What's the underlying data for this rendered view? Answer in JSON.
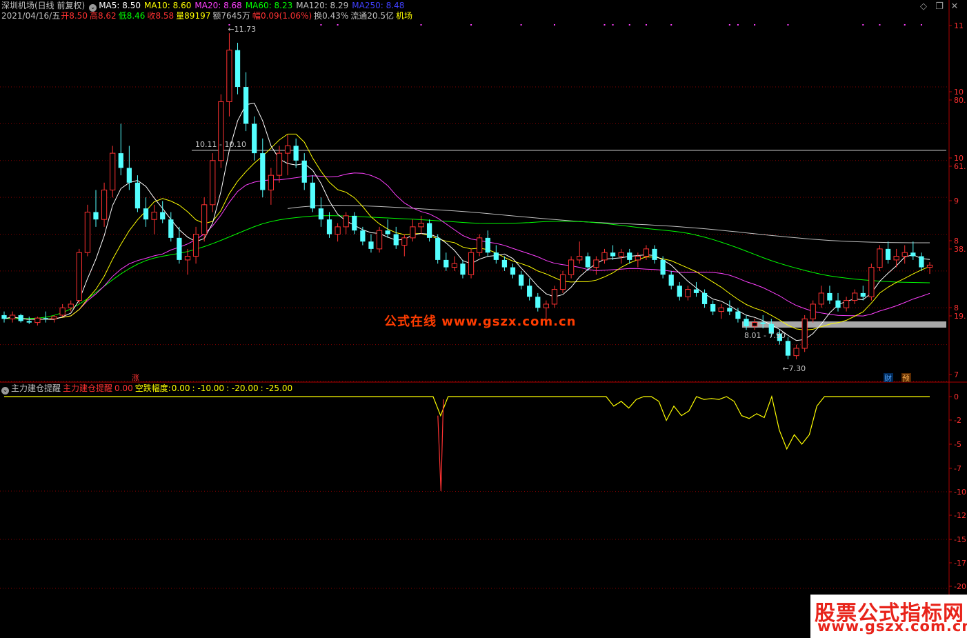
{
  "header": {
    "title": "深圳机场(日线 前复权)",
    "ma": [
      {
        "label": "MA5:",
        "value": "8.50",
        "color": "#ffffff"
      },
      {
        "label": "MA10:",
        "value": "8.60",
        "color": "#ffff00"
      },
      {
        "label": "MA20:",
        "value": "8.68",
        "color": "#ff40ff"
      },
      {
        "label": "MA60:",
        "value": "8.23",
        "color": "#00ff00"
      },
      {
        "label": "MA120:",
        "value": "8.29",
        "color": "#c0c0c0"
      },
      {
        "label": "MA250:",
        "value": "8.48",
        "color": "#4040ff"
      }
    ],
    "date": "2021/04/16/五",
    "open_label": "开",
    "open": "8.50",
    "high_label": "高",
    "high": "8.62",
    "low_label": "低",
    "low": "8.46",
    "close_label": "收",
    "close": "8.58",
    "volume_label": "量",
    "volume": "89197",
    "amount_label": "额",
    "amount": "7645万",
    "change_label": "幅",
    "change": "0.09(1.06%)",
    "turnover_label": "换",
    "turnover": "0.43%",
    "float_label": "流通",
    "float": "20.5亿",
    "sector": "机场"
  },
  "indicator": {
    "name": "主力建仓提醒",
    "line_name": "主力建仓提醒",
    "line_value": "0.00",
    "fall_label": "空跌幅度:",
    "fall_values": [
      "0.00",
      "-10.00",
      "-20.00",
      "-25.00"
    ]
  },
  "annotations": {
    "high": "11.73",
    "low": "7.30",
    "level1": "10.11 - 10.10",
    "level2": "8.01 - 7.90",
    "limit_up": "涨",
    "fin": "财",
    "pre": "预"
  },
  "watermark": {
    "mid": "公式在线  www.gszx.com.cn",
    "corner1": "股票公式指标网",
    "corner2": "www.gszx.com.cn"
  },
  "colors": {
    "up": "#ff3232",
    "down": "#54ffff",
    "ma5": "#ffffff",
    "ma10": "#ffff00",
    "ma20": "#ff40ff",
    "ma60": "#00ff00",
    "ma120": "#c0c0c0",
    "ma250": "#4040ff",
    "grid": "#8b0000",
    "axis": "#b00000"
  },
  "chart_data": [
    {
      "type": "candlestick",
      "title": "深圳机场(日线 前复权)",
      "y_ticks_visible": [
        "11",
        "10",
        "80.",
        "10",
        "61.",
        "9",
        "8",
        "38.",
        "8",
        "19.",
        "7"
      ],
      "ylim": [
        7.0,
        11.9
      ],
      "annotations": {
        "max": 11.73,
        "min": 7.3,
        "h_line": 10.1
      },
      "candles": [
        [
          7.9,
          7.95,
          7.8,
          7.85
        ],
        [
          7.85,
          7.95,
          7.8,
          7.9
        ],
        [
          7.9,
          7.92,
          7.8,
          7.82
        ],
        [
          7.82,
          7.88,
          7.78,
          7.8
        ],
        [
          7.8,
          7.88,
          7.76,
          7.86
        ],
        [
          7.86,
          7.95,
          7.8,
          7.85
        ],
        [
          7.85,
          7.9,
          7.8,
          7.88
        ],
        [
          7.9,
          8.05,
          7.88,
          8.0
        ],
        [
          8.0,
          8.1,
          7.95,
          8.05
        ],
        [
          8.1,
          8.8,
          8.05,
          8.75
        ],
        [
          8.75,
          9.4,
          8.7,
          9.3
        ],
        [
          9.3,
          9.6,
          9.1,
          9.2
        ],
        [
          9.2,
          9.7,
          9.1,
          9.6
        ],
        [
          9.6,
          10.2,
          9.5,
          10.1
        ],
        [
          10.1,
          10.5,
          9.8,
          9.9
        ],
        [
          9.9,
          10.2,
          9.6,
          9.7
        ],
        [
          9.7,
          9.8,
          9.3,
          9.35
        ],
        [
          9.35,
          9.5,
          9.1,
          9.2
        ],
        [
          9.2,
          9.4,
          9.0,
          9.3
        ],
        [
          9.3,
          9.45,
          9.15,
          9.2
        ],
        [
          9.2,
          9.3,
          8.9,
          8.95
        ],
        [
          8.95,
          9.1,
          8.6,
          8.65
        ],
        [
          8.65,
          8.8,
          8.45,
          8.7
        ],
        [
          8.7,
          9.1,
          8.6,
          9.0
        ],
        [
          9.0,
          9.5,
          8.9,
          9.4
        ],
        [
          9.4,
          10.1,
          9.3,
          10.0
        ],
        [
          10.0,
          10.9,
          9.9,
          10.8
        ],
        [
          10.8,
          11.73,
          10.6,
          11.5
        ],
        [
          11.5,
          11.6,
          10.9,
          11.0
        ],
        [
          11.0,
          11.2,
          10.4,
          10.5
        ],
        [
          10.5,
          10.6,
          10.0,
          10.1
        ],
        [
          10.1,
          10.3,
          9.5,
          9.6
        ],
        [
          9.6,
          9.9,
          9.4,
          9.8
        ],
        [
          9.8,
          10.2,
          9.7,
          10.1
        ],
        [
          10.1,
          10.35,
          9.8,
          10.2
        ],
        [
          10.2,
          10.3,
          9.9,
          10.0
        ],
        [
          10.0,
          10.1,
          9.6,
          9.7
        ],
        [
          9.7,
          9.8,
          9.3,
          9.35
        ],
        [
          9.35,
          9.5,
          9.1,
          9.2
        ],
        [
          9.2,
          9.3,
          8.95,
          9.0
        ],
        [
          9.0,
          9.15,
          8.9,
          9.1
        ],
        [
          9.1,
          9.3,
          9.0,
          9.25
        ],
        [
          9.25,
          9.3,
          9.0,
          9.05
        ],
        [
          9.05,
          9.1,
          8.85,
          8.9
        ],
        [
          8.9,
          9.0,
          8.75,
          8.8
        ],
        [
          8.8,
          9.1,
          8.75,
          9.05
        ],
        [
          9.05,
          9.2,
          8.95,
          9.0
        ],
        [
          9.0,
          9.1,
          8.8,
          8.85
        ],
        [
          8.85,
          9.0,
          8.7,
          8.95
        ],
        [
          8.95,
          9.2,
          8.9,
          9.1
        ],
        [
          9.1,
          9.25,
          9.0,
          9.15
        ],
        [
          9.15,
          9.2,
          8.9,
          8.95
        ],
        [
          8.95,
          9.0,
          8.6,
          8.65
        ],
        [
          8.65,
          8.75,
          8.5,
          8.55
        ],
        [
          8.55,
          8.7,
          8.5,
          8.6
        ],
        [
          8.6,
          8.65,
          8.4,
          8.45
        ],
        [
          8.45,
          8.8,
          8.4,
          8.75
        ],
        [
          8.75,
          9.0,
          8.7,
          8.95
        ],
        [
          8.95,
          9.05,
          8.7,
          8.75
        ],
        [
          8.75,
          8.85,
          8.6,
          8.65
        ],
        [
          8.65,
          8.7,
          8.5,
          8.55
        ],
        [
          8.55,
          8.6,
          8.4,
          8.45
        ],
        [
          8.45,
          8.5,
          8.25,
          8.3
        ],
        [
          8.3,
          8.4,
          8.1,
          8.15
        ],
        [
          8.15,
          8.2,
          7.95,
          8.0
        ],
        [
          8.0,
          8.1,
          7.85,
          8.05
        ],
        [
          8.05,
          8.3,
          8.0,
          8.25
        ],
        [
          8.25,
          8.5,
          8.2,
          8.45
        ],
        [
          8.45,
          8.7,
          8.4,
          8.65
        ],
        [
          8.65,
          8.9,
          8.6,
          8.7
        ],
        [
          8.7,
          8.75,
          8.5,
          8.55
        ],
        [
          8.55,
          8.7,
          8.45,
          8.65
        ],
        [
          8.65,
          8.8,
          8.6,
          8.75
        ],
        [
          8.75,
          8.85,
          8.65,
          8.7
        ],
        [
          8.7,
          8.8,
          8.6,
          8.75
        ],
        [
          8.75,
          8.8,
          8.6,
          8.65
        ],
        [
          8.65,
          8.75,
          8.55,
          8.7
        ],
        [
          8.7,
          8.85,
          8.65,
          8.8
        ],
        [
          8.8,
          8.85,
          8.6,
          8.65
        ],
        [
          8.65,
          8.7,
          8.4,
          8.45
        ],
        [
          8.45,
          8.5,
          8.25,
          8.3
        ],
        [
          8.3,
          8.35,
          8.1,
          8.15
        ],
        [
          8.15,
          8.3,
          8.1,
          8.25
        ],
        [
          8.25,
          8.35,
          8.15,
          8.2
        ],
        [
          8.2,
          8.25,
          8.0,
          8.05
        ],
        [
          8.05,
          8.1,
          7.9,
          7.95
        ],
        [
          7.95,
          8.05,
          7.85,
          8.0
        ],
        [
          8.0,
          8.1,
          7.9,
          7.95
        ],
        [
          7.95,
          8.0,
          7.8,
          7.85
        ],
        [
          7.85,
          7.9,
          7.7,
          7.75
        ],
        [
          7.75,
          7.85,
          7.7,
          7.8
        ],
        [
          7.8,
          7.9,
          7.72,
          7.78
        ],
        [
          7.78,
          7.85,
          7.6,
          7.65
        ],
        [
          7.65,
          7.7,
          7.5,
          7.55
        ],
        [
          7.55,
          7.6,
          7.3,
          7.35
        ],
        [
          7.35,
          7.5,
          7.3,
          7.45
        ],
        [
          7.45,
          7.9,
          7.4,
          7.85
        ],
        [
          7.85,
          8.1,
          7.8,
          8.05
        ],
        [
          8.05,
          8.3,
          8.0,
          8.2
        ],
        [
          8.2,
          8.3,
          8.05,
          8.1
        ],
        [
          8.1,
          8.2,
          7.95,
          8.0
        ],
        [
          8.0,
          8.15,
          7.95,
          8.1
        ],
        [
          8.1,
          8.25,
          8.05,
          8.2
        ],
        [
          8.2,
          8.3,
          8.1,
          8.15
        ],
        [
          8.15,
          8.6,
          8.1,
          8.55
        ],
        [
          8.55,
          8.85,
          8.5,
          8.8
        ],
        [
          8.8,
          8.9,
          8.6,
          8.65
        ],
        [
          8.65,
          8.8,
          8.55,
          8.7
        ],
        [
          8.7,
          8.85,
          8.6,
          8.75
        ],
        [
          8.75,
          8.9,
          8.65,
          8.7
        ],
        [
          8.7,
          8.75,
          8.5,
          8.55
        ],
        [
          8.55,
          8.62,
          8.46,
          8.58
        ]
      ]
    },
    {
      "type": "line",
      "title": "主力建仓提醒",
      "series": [
        {
          "name": "主力建仓提醒",
          "values_note": "spike",
          "spike": {
            "index": 58,
            "value": -10.0
          }
        },
        {
          "name": "空跌幅度",
          "values": [
            0,
            0,
            0,
            0,
            0,
            0,
            0,
            0,
            0,
            0,
            0,
            0,
            0,
            0,
            0,
            0,
            0,
            0,
            0,
            0,
            0,
            0,
            0,
            0,
            0,
            0,
            0,
            0,
            0,
            0,
            0,
            0,
            0,
            0,
            0,
            0,
            0,
            0,
            0,
            0,
            0,
            0,
            0,
            0,
            0,
            0,
            0,
            0,
            0,
            0,
            0,
            0,
            0,
            0,
            0,
            0,
            0,
            0,
            -2,
            0,
            0,
            0,
            0,
            0,
            0,
            0,
            0,
            0,
            0,
            0,
            0,
            0,
            0,
            0,
            0,
            0,
            0,
            0,
            0,
            0,
            0,
            -1,
            -0.5,
            -1.2,
            -0.3,
            0,
            0,
            -0.5,
            -2.5,
            -1,
            -2,
            -1.5,
            0,
            -0.3,
            -0.2,
            -0.3,
            0,
            -0.5,
            -2,
            -2.3,
            -1.8,
            -2.2,
            0,
            -3.5,
            -5.5,
            -4,
            -5,
            -4,
            -1,
            0,
            0,
            0,
            0,
            0,
            0,
            0,
            0,
            0,
            0,
            0,
            0,
            0,
            0,
            0
          ]
        }
      ],
      "y_ticks": [
        "0",
        "-2",
        "-5",
        "-7",
        "-10",
        "-12",
        "-15",
        "-17",
        "-20"
      ],
      "ylim": [
        -20.5,
        0.5
      ]
    }
  ]
}
